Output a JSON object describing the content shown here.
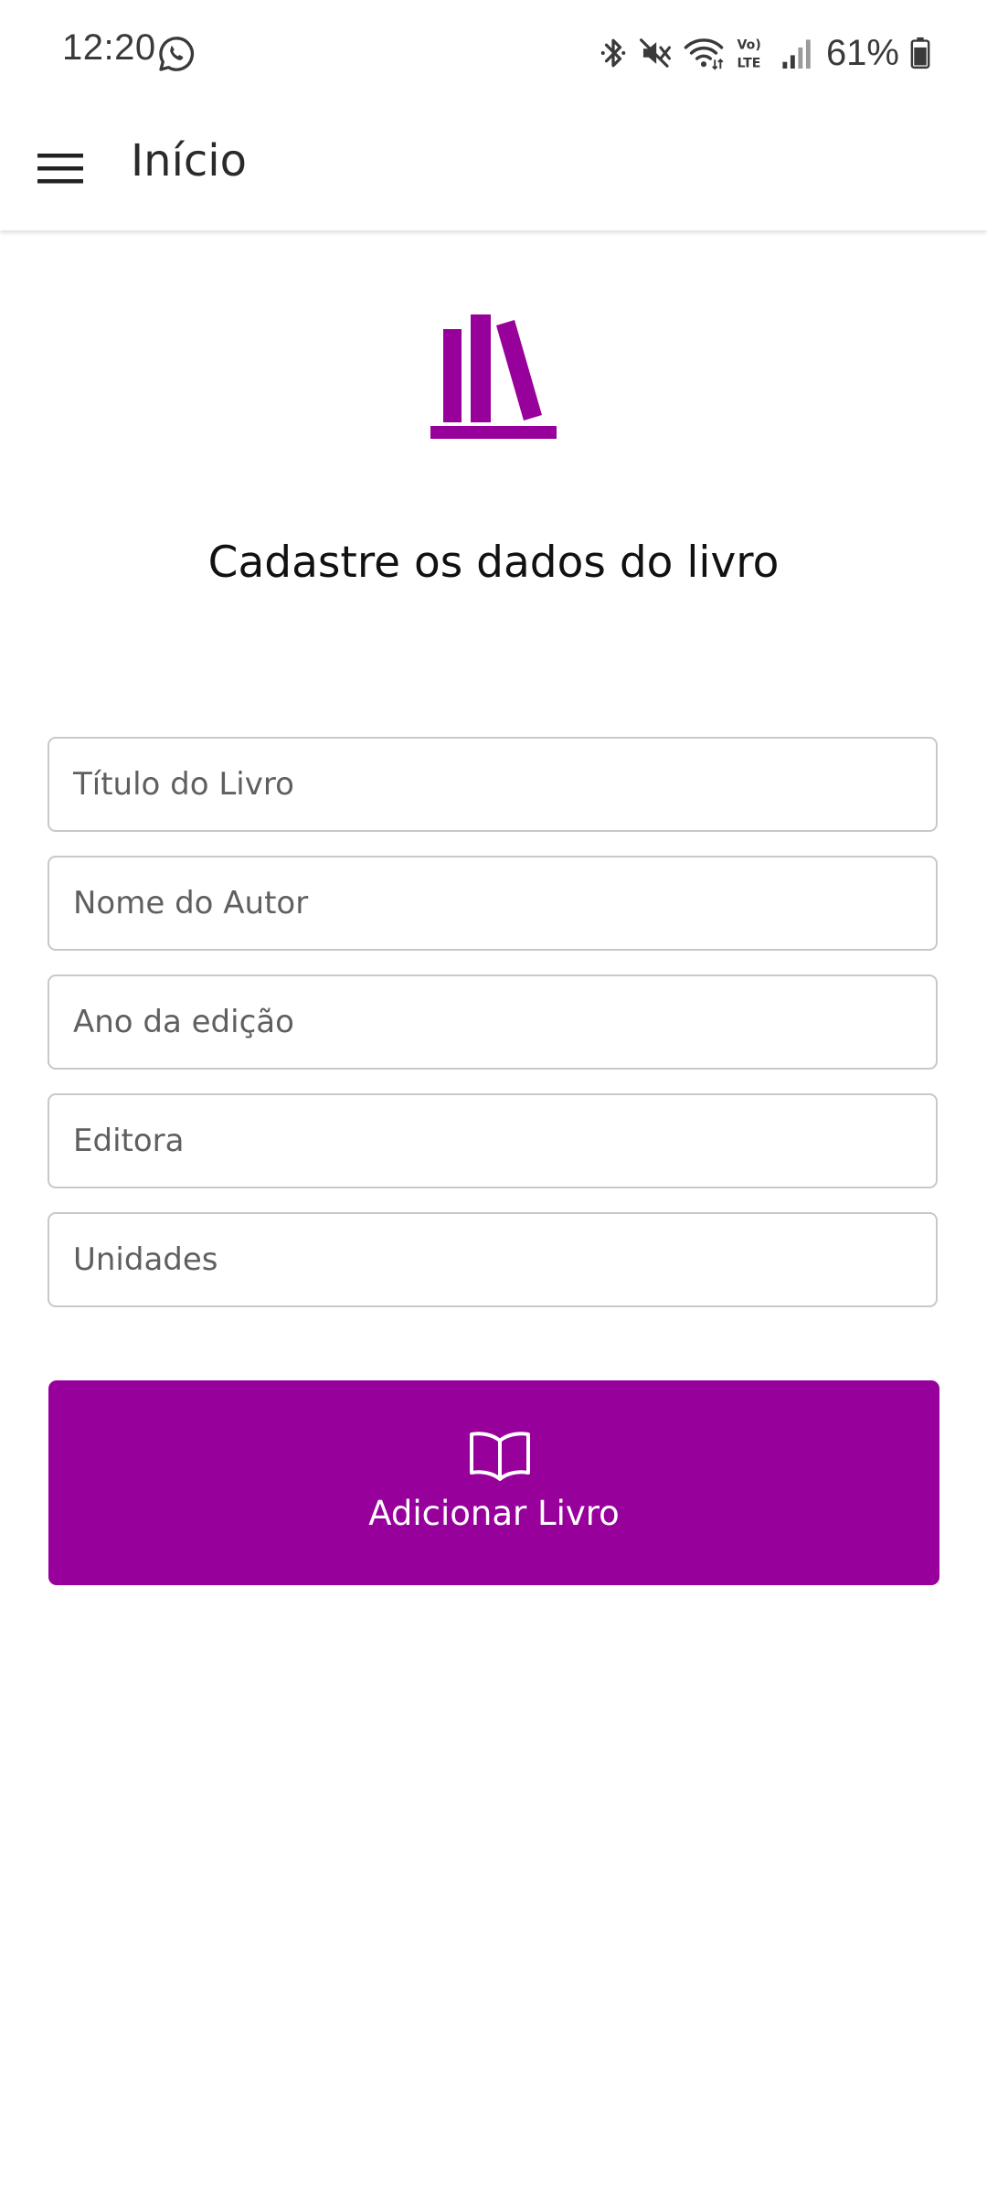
{
  "status_bar": {
    "time": "12:20",
    "battery_percent": "61%",
    "icons": [
      "whatsapp-icon",
      "bluetooth-icon",
      "mute-icon",
      "wifi-icon",
      "volte-icon",
      "signal-icon",
      "battery-icon"
    ]
  },
  "app_bar": {
    "title": "Início",
    "menu_icon": "hamburger-menu-icon"
  },
  "content": {
    "hero_icon": "bookshelf-icon",
    "heading": "Cadastre os dados do livro",
    "fields": [
      {
        "placeholder": "Título do Livro",
        "value": ""
      },
      {
        "placeholder": "Nome do Autor",
        "value": ""
      },
      {
        "placeholder": "Ano da edição",
        "value": ""
      },
      {
        "placeholder": "Editora",
        "value": ""
      },
      {
        "placeholder": "Unidades",
        "value": ""
      }
    ],
    "submit_button": {
      "label": "Adicionar Livro",
      "icon": "open-book-icon"
    }
  },
  "colors": {
    "accent": "#98009c",
    "field_border": "#c8c8c8",
    "background": "#ffffff"
  }
}
